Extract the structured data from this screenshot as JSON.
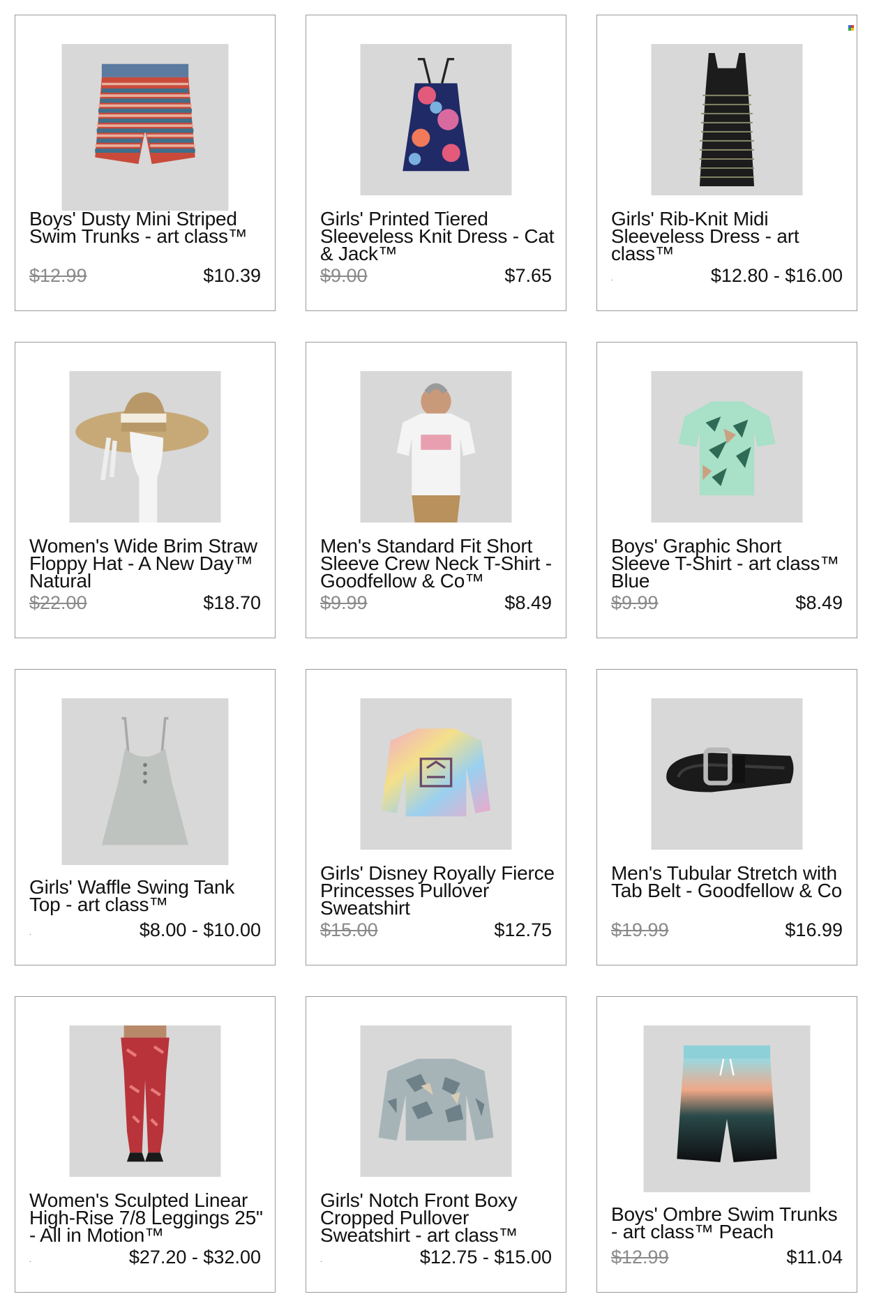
{
  "products": [
    {
      "title": "Boys' Dusty Mini Striped Swim Trunks - art class™",
      "was": "$12.99",
      "price": "$10.39",
      "icon": "swim-trunks-striped"
    },
    {
      "title": "Girls' Printed Tiered Sleeveless Knit Dress - Cat & Jack™",
      "was": "$9.00",
      "price": "$7.65",
      "icon": "floral-dress"
    },
    {
      "title": "Girls' Rib-Knit Midi Sleeveless Dress - art class™",
      "was": "",
      "price": "$12.80 - $16.00",
      "icon": "striped-midi-dress"
    },
    {
      "title": "Women's Wide Brim Straw Floppy Hat - A New Day™ Natural",
      "was": "$22.00",
      "price": "$18.70",
      "icon": "straw-hat"
    },
    {
      "title": "Men's Standard Fit Short Sleeve Crew Neck T-Shirt - Goodfellow & Co™",
      "was": "$9.99",
      "price": "$8.49",
      "icon": "man-tshirt"
    },
    {
      "title": "Boys' Graphic Short Sleeve T-Shirt - art class™ Blue",
      "was": "$9.99",
      "price": "$8.49",
      "icon": "graphic-tshirt"
    },
    {
      "title": "Girls' Waffle Swing Tank Top - art class™",
      "was": "",
      "price": "$8.00 - $10.00",
      "icon": "tank-top"
    },
    {
      "title": "Girls' Disney Royally Fierce Princesses Pullover Sweatshirt",
      "was": "$15.00",
      "price": "$12.75",
      "icon": "tie-dye-sweatshirt"
    },
    {
      "title": "Men's Tubular Stretch with Tab Belt - Goodfellow & Co",
      "was": "$19.99",
      "price": "$16.99",
      "icon": "belt"
    },
    {
      "title": "Women's Sculpted Linear High-Rise 7/8 Leggings 25\" - All in Motion™",
      "was": "",
      "price": "$27.20 - $32.00",
      "icon": "leggings"
    },
    {
      "title": "Girls' Notch Front Boxy Cropped Pullover Sweatshirt - art class™",
      "was": "",
      "price": "$12.75 - $15.00",
      "icon": "camo-sweatshirt"
    },
    {
      "title": "Boys' Ombre Swim Trunks - art class™ Peach",
      "was": "$12.99",
      "price": "$11.04",
      "icon": "ombre-swim-trunks"
    }
  ],
  "list_marker": ".",
  "colors": {
    "border": "#9a9a9a",
    "thumb_bg": "#d9d9d9",
    "strike": "#8a8a8a"
  }
}
